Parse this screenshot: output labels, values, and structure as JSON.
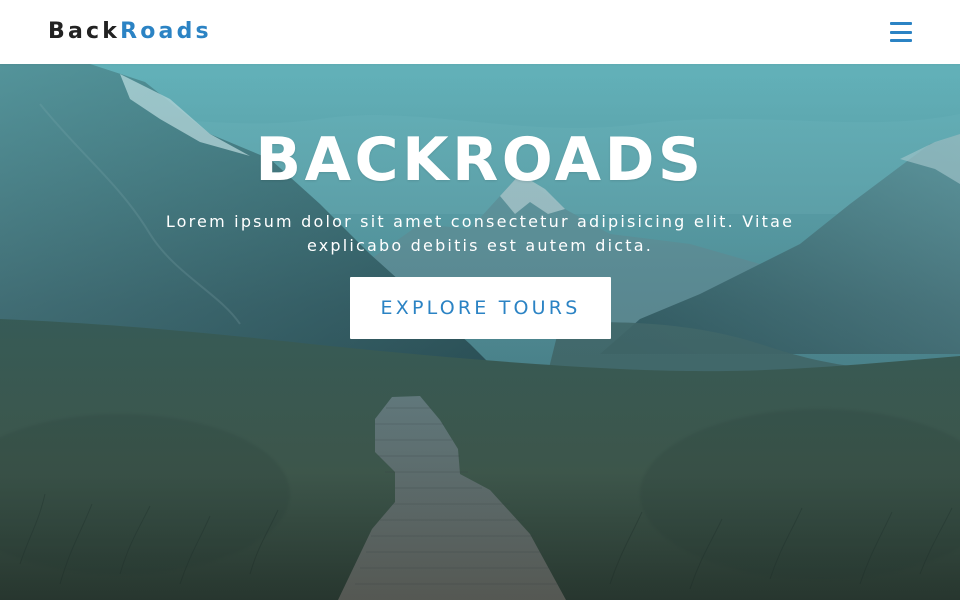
{
  "navbar": {
    "logo_part_1": "Back",
    "logo_part_2": "Roads",
    "menu_icon": "hamburger-menu-icon"
  },
  "hero": {
    "title": "BACKROADS",
    "subtitle": "Lorem ipsum dolor sit amet consectetur adipisicing elit. Vitae explicabo debitis est autem dicta.",
    "cta_label": "EXPLORE TOURS"
  },
  "colors": {
    "brand_dark": "#222222",
    "brand_accent": "#2b83c4",
    "overlay_teal": "#3aa0aa"
  }
}
